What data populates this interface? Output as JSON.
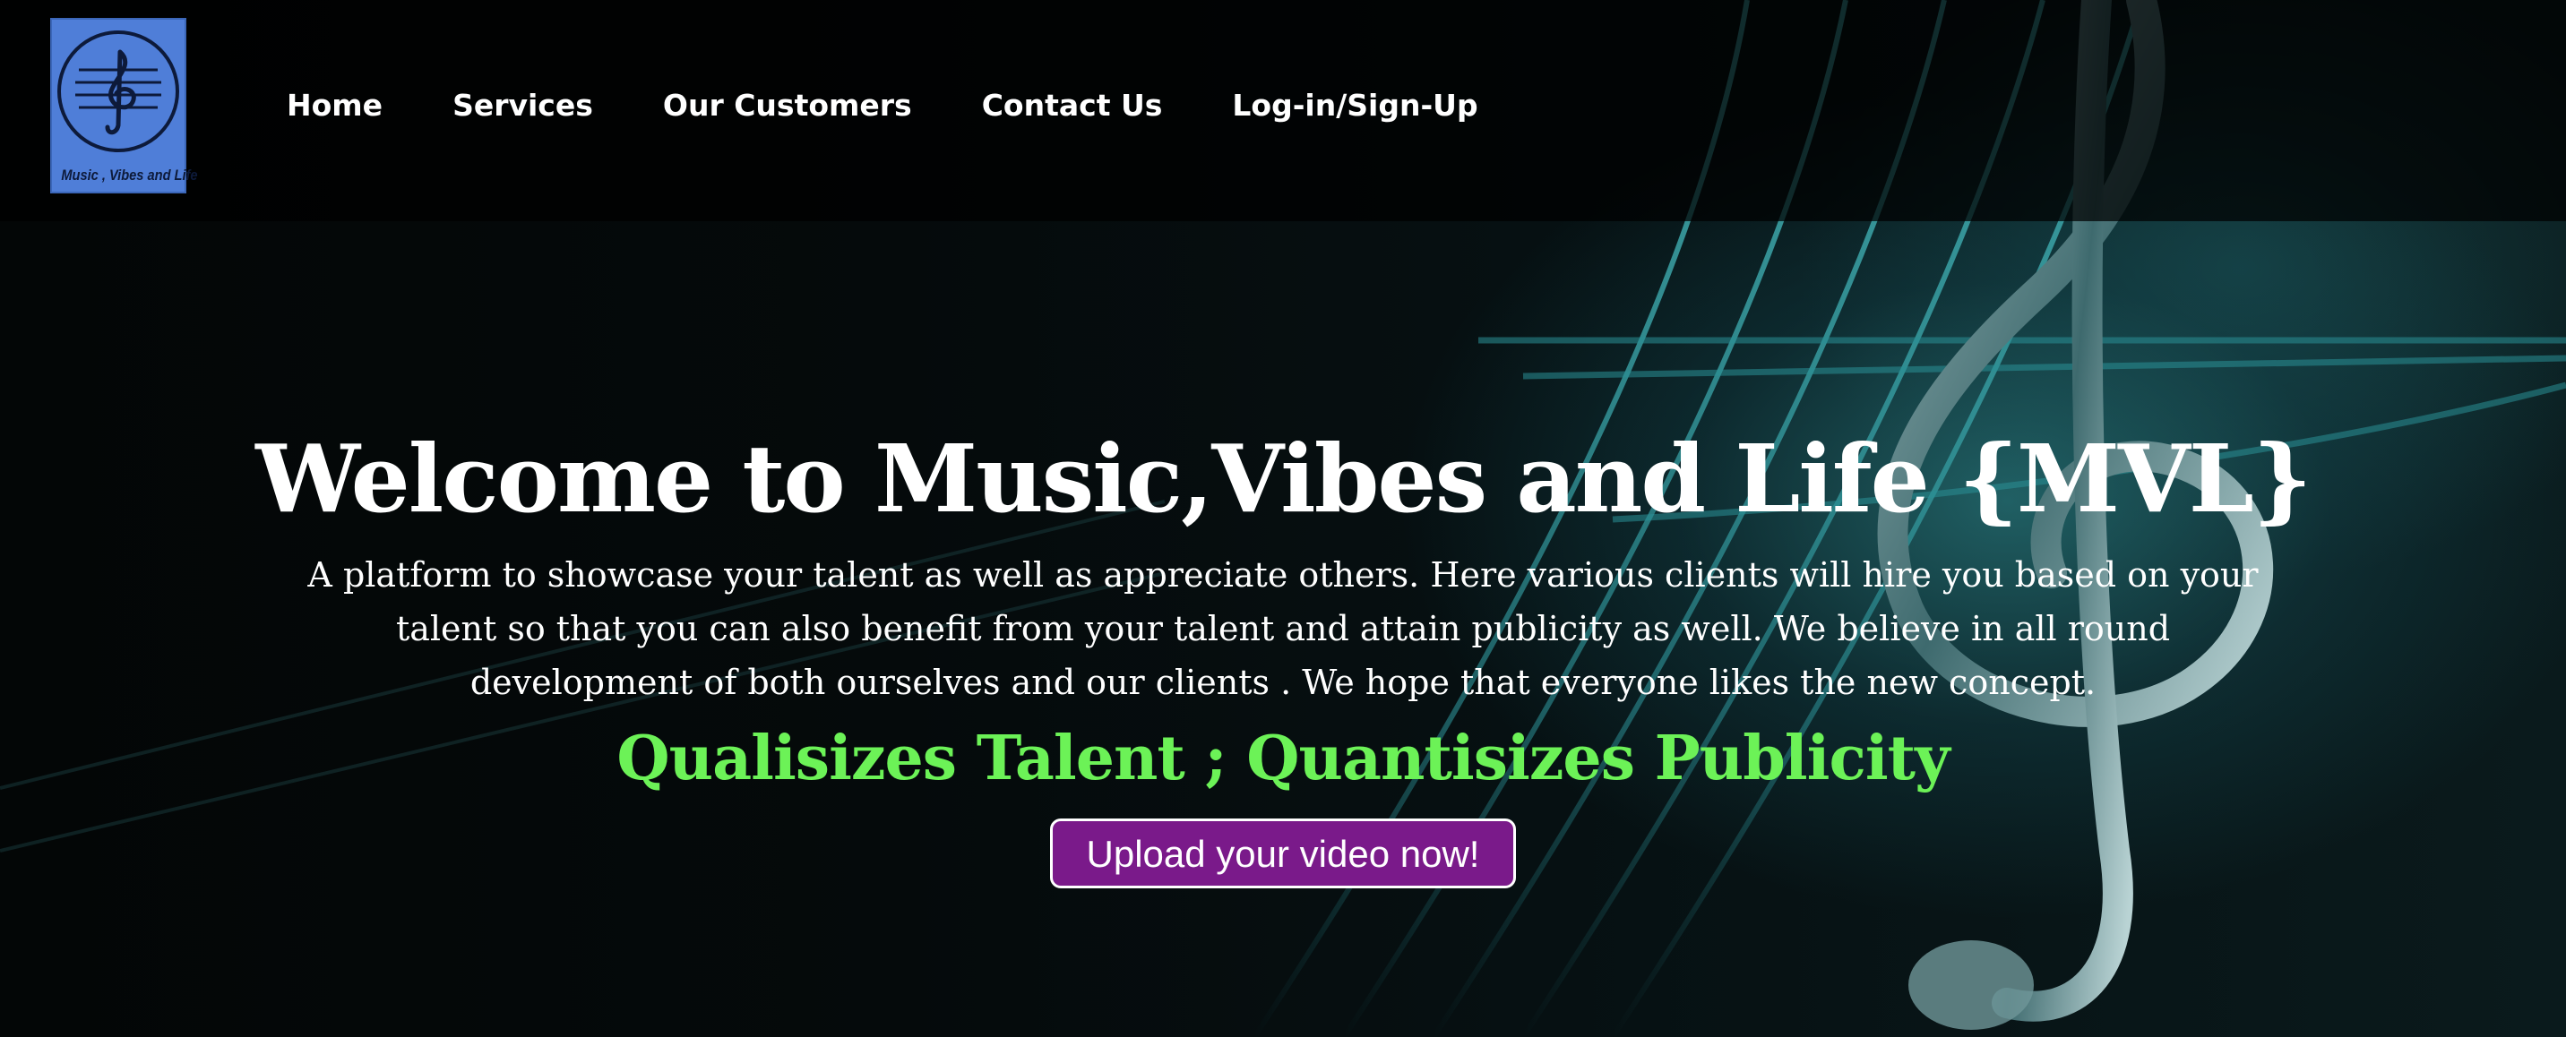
{
  "logo": {
    "text": "Music , Vibes and Life",
    "color": "#4f7ed8"
  },
  "nav": {
    "items": [
      {
        "label": "Home"
      },
      {
        "label": "Services"
      },
      {
        "label": "Our Customers"
      },
      {
        "label": "Contact Us"
      },
      {
        "label": "Log-in/Sign-Up"
      }
    ]
  },
  "hero": {
    "title": "Welcome to Music,Vibes and Life {MVL}",
    "description": "A platform to showcase your talent as well as appreciate others. Here various clients will hire you based on your talent so that you can also benefit from your talent and attain publicity as well. We believe in all round development of both ourselves and our clients . We hope that everyone likes the new concept.",
    "tagline": "Qualisizes Talent ; Quantisizes Publicity",
    "tagline_color": "#6cf257",
    "button_label": "Upload your video now!",
    "button_color": "#7a1a8a"
  },
  "icons": {
    "logo_emblem": "treble-clef-icon",
    "background": "treble-clef-icon"
  }
}
